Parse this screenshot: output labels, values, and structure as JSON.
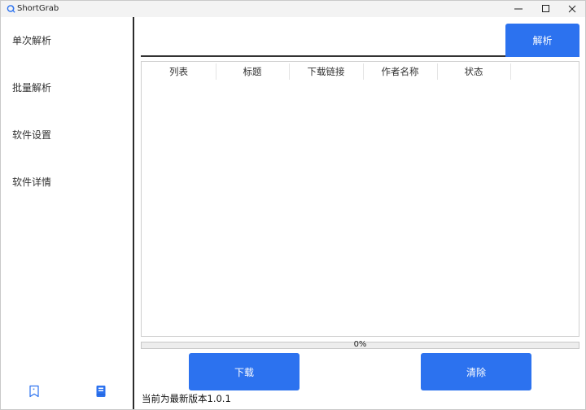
{
  "window": {
    "title": "ShortGrab"
  },
  "sidebar": {
    "items": [
      {
        "label": "单次解析"
      },
      {
        "label": "批量解析"
      },
      {
        "label": "软件设置"
      },
      {
        "label": "软件详情"
      }
    ]
  },
  "url_input": {
    "value": "",
    "placeholder": ""
  },
  "parse_button": {
    "label": "解析"
  },
  "table": {
    "columns": [
      "列表",
      "标题",
      "下载链接",
      "作者名称",
      "状态"
    ],
    "rows": []
  },
  "progress": {
    "value": 0,
    "label": "0%"
  },
  "actions": {
    "download_label": "下载",
    "clear_label": "清除"
  },
  "status": {
    "text": "当前为最新版本1.0.1"
  },
  "colors": {
    "accent": "#2c72ef",
    "sidebar_separator": "#2b2b2b"
  }
}
